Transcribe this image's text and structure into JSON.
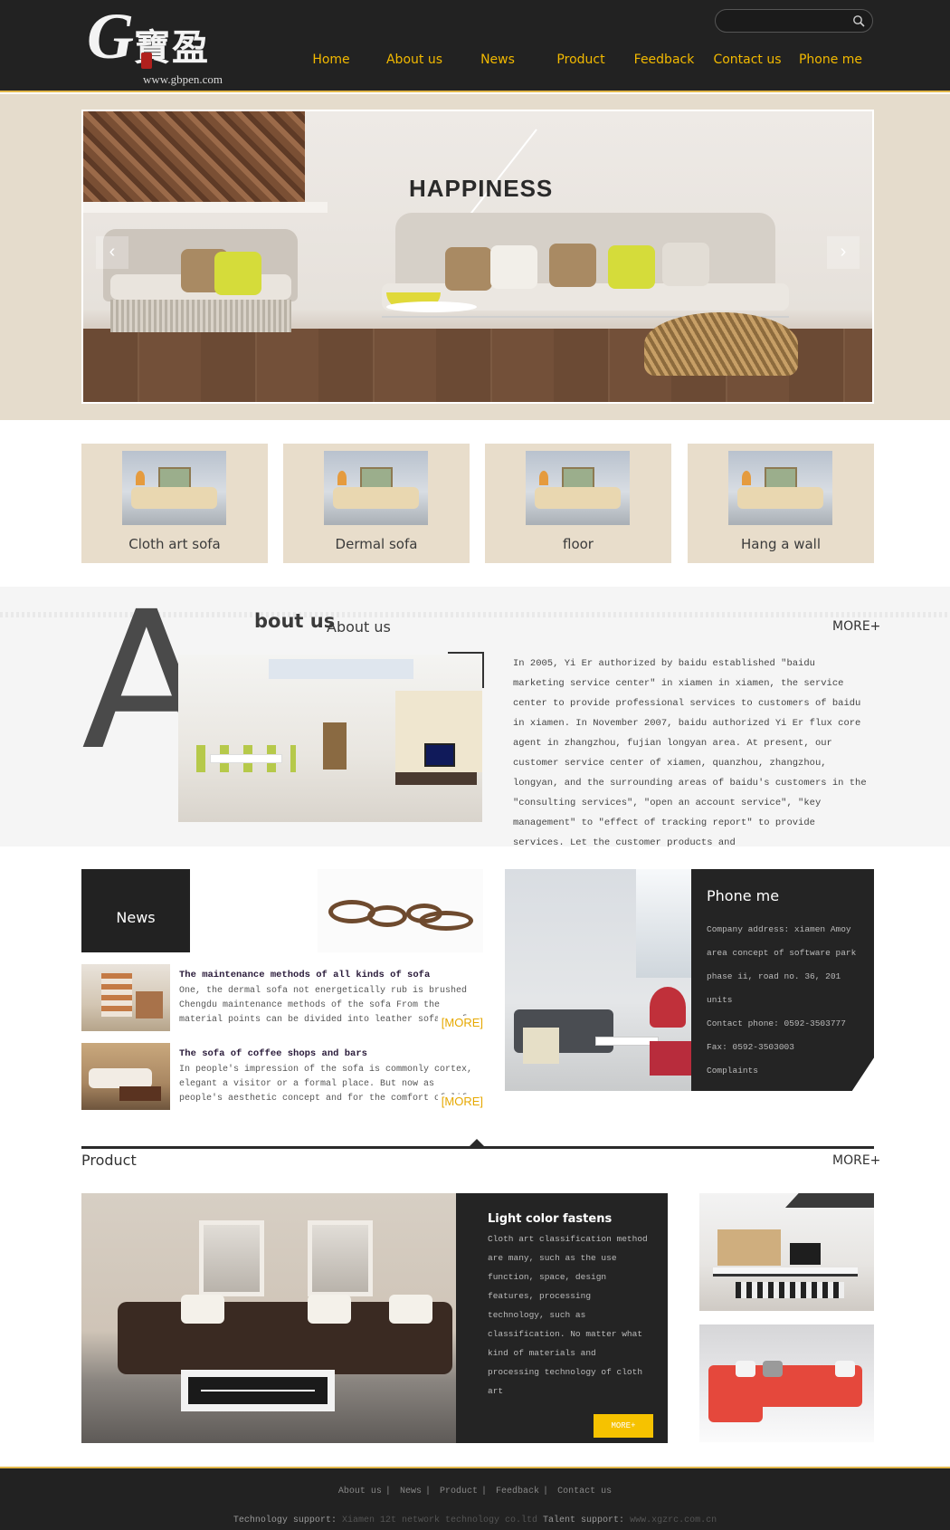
{
  "header": {
    "logo": {
      "letter": "G",
      "chinese": "寶盈",
      "url": "www.gbpen.com"
    },
    "search": {
      "placeholder": "",
      "icon": "search-icon"
    },
    "nav": [
      "Home",
      "About us",
      "News",
      "Product",
      "Feedback",
      "Contact us",
      "Phone me"
    ]
  },
  "banner": {
    "title": "HAPPINESS",
    "prev_icon": "chevron-left-icon",
    "next_icon": "chevron-right-icon"
  },
  "categories": [
    "Cloth art sofa",
    "Dermal sofa",
    "floor",
    "Hang a wall"
  ],
  "about": {
    "big_letter": "A",
    "title_part": "bout us",
    "subtitle": "About us",
    "more": "MORE+",
    "text": "In 2005, Yi Er authorized by baidu established \"baidu marketing service center\" in xiamen in xiamen, the service center to provide professional services to customers of baidu in xiamen. In November 2007, baidu authorized Yi Er flux core agent in zhangzhou, fujian longyan area. At present, our customer service center of xiamen, quanzhou, zhangzhou, longyan, and the surrounding areas of baidu's customers in the \"consulting services\", \"open an account service\", \"key management\" to \"effect of tracking report\" to provide services. Let the customer products and"
  },
  "news": {
    "label": "News",
    "items": [
      {
        "title": "The maintenance methods of all kinds of sofa",
        "text": "One, the dermal sofa not energetically rub is brushed Chengdu maintenance methods of the sofa From the material points can be divided into leather sofa, sofa cloth art sofa, wooden sofa",
        "more": "[MORE]"
      },
      {
        "title": "The sofa of coffee shops and bars",
        "text": "In people's impression of the sofa is commonly cortex, elegant a visitor or a formal place. But now as people's aesthetic concept and for the comfort of life more and more strict",
        "more": "[MORE]"
      }
    ]
  },
  "phone": {
    "title": "Phone me",
    "lines": [
      "Company address: xiamen Amoy area concept of software park phase ii, road no. 36, 201 units",
      "Contact phone: 0592-3503777",
      "Fax: 0592-3503003",
      "Complaints"
    ]
  },
  "product": {
    "title": "Product",
    "more": "MORE+",
    "feature_title": "Light color fastens",
    "feature_text": "Cloth art classification method are many, such as the use function, space, design features, processing technology, such as classification. No matter what kind of materials and processing technology of cloth art",
    "feature_more": "MORE+"
  },
  "footer": {
    "links": [
      "About us",
      "News",
      "Product",
      "Feedback",
      "Contact us"
    ],
    "tech_label": "Technology support:",
    "tech_value": "Xiamen 12t network technology co.ltd",
    "talent_label": "Talent support:",
    "talent_value": "www.xgzrc.com.cn"
  },
  "colors": {
    "header_bg": "#222222",
    "nav_text": "#f2b900",
    "banner_bg": "#e5dccc",
    "category_bg": "#e8ddcb",
    "dark_box": "#242424",
    "accent": "#f6c200"
  }
}
